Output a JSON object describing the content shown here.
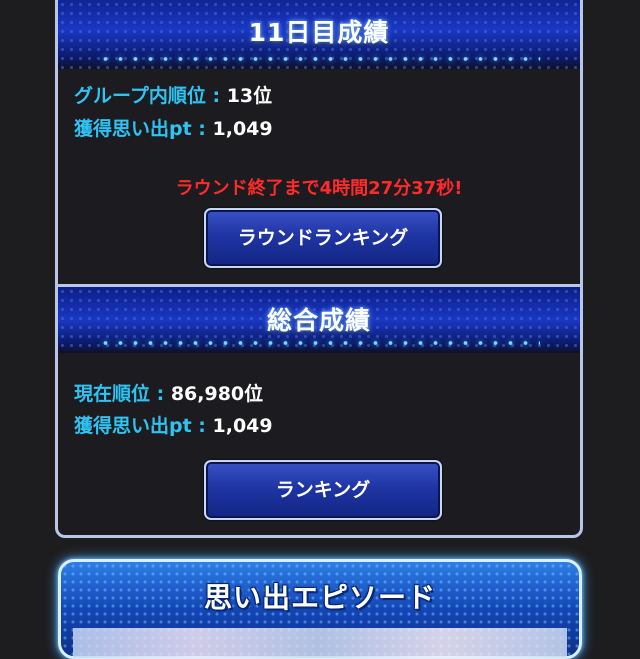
{
  "day_panel": {
    "title": "11日目成績",
    "group_rank_label": "グループ内順位 : ",
    "group_rank_value": "13位",
    "points_label": "獲得思い出pt : ",
    "points_value": "1,049",
    "countdown": "ラウンド終了まで4時間27分37秒!",
    "button_label": "ラウンドランキング"
  },
  "total_panel": {
    "title": "総合成績",
    "rank_label": "現在順位 : ",
    "rank_value": "86,980位",
    "points_label": "獲得思い出pt : ",
    "points_value": "1,049",
    "button_label": "ランキング"
  },
  "episode_panel": {
    "title": "思い出エピソード"
  },
  "colors": {
    "label": "#2ec3f2",
    "value": "#ffffff",
    "countdown": "#ff2a2a",
    "header_blue": "#1a37c3"
  }
}
